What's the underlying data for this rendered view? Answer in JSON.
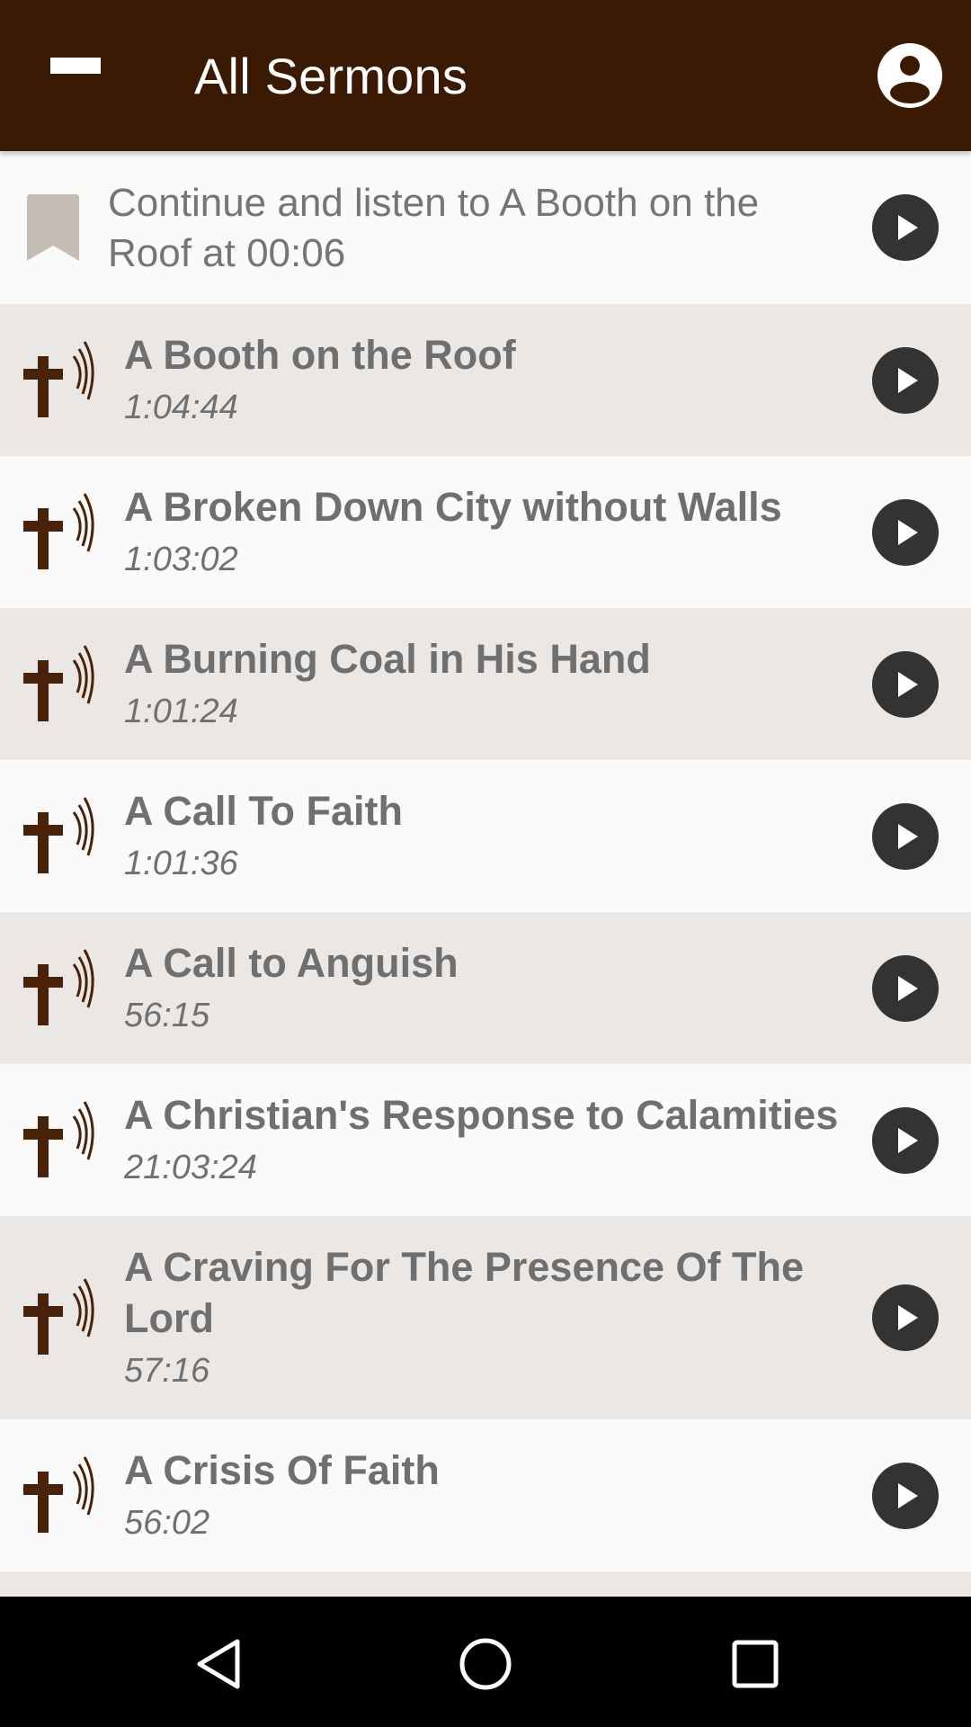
{
  "toolbar": {
    "title": "All Sermons",
    "menu_icon": "hamburger-menu-icon",
    "account_icon": "account-circle-icon",
    "background_color": "#3b1a03"
  },
  "continue": {
    "text": "Continue and listen to A Booth on the Roof at 00:06",
    "icon": "bookmark-icon",
    "action_icon": "play-circle-icon"
  },
  "sermons": [
    {
      "title": "A Booth on the Roof",
      "duration": "1:04:44"
    },
    {
      "title": "A Broken Down City without Walls",
      "duration": "1:03:02"
    },
    {
      "title": "A Burning Coal in His Hand",
      "duration": "1:01:24"
    },
    {
      "title": "A Call To Faith",
      "duration": "1:01:36"
    },
    {
      "title": "A Call to Anguish",
      "duration": "56:15"
    },
    {
      "title": "A Christian's Response to Calamities",
      "duration": "21:03:24"
    },
    {
      "title": "A Craving For The Presence Of The Lord",
      "duration": "57:16"
    },
    {
      "title": "A Crisis Of Faith",
      "duration": "56:02"
    }
  ],
  "sermon_icon": "cross-audio-icon",
  "colors": {
    "accent_brown": "#3b1a03",
    "row_light": "#fafafa",
    "row_dark": "#ebe7e5",
    "play_button": "#333333",
    "bookmark": "#c5bcb4",
    "text_gray": "#6f6f6f"
  },
  "navbar": {
    "back_icon": "back-triangle-icon",
    "home_icon": "home-circle-icon",
    "recents_icon": "recents-square-icon"
  }
}
